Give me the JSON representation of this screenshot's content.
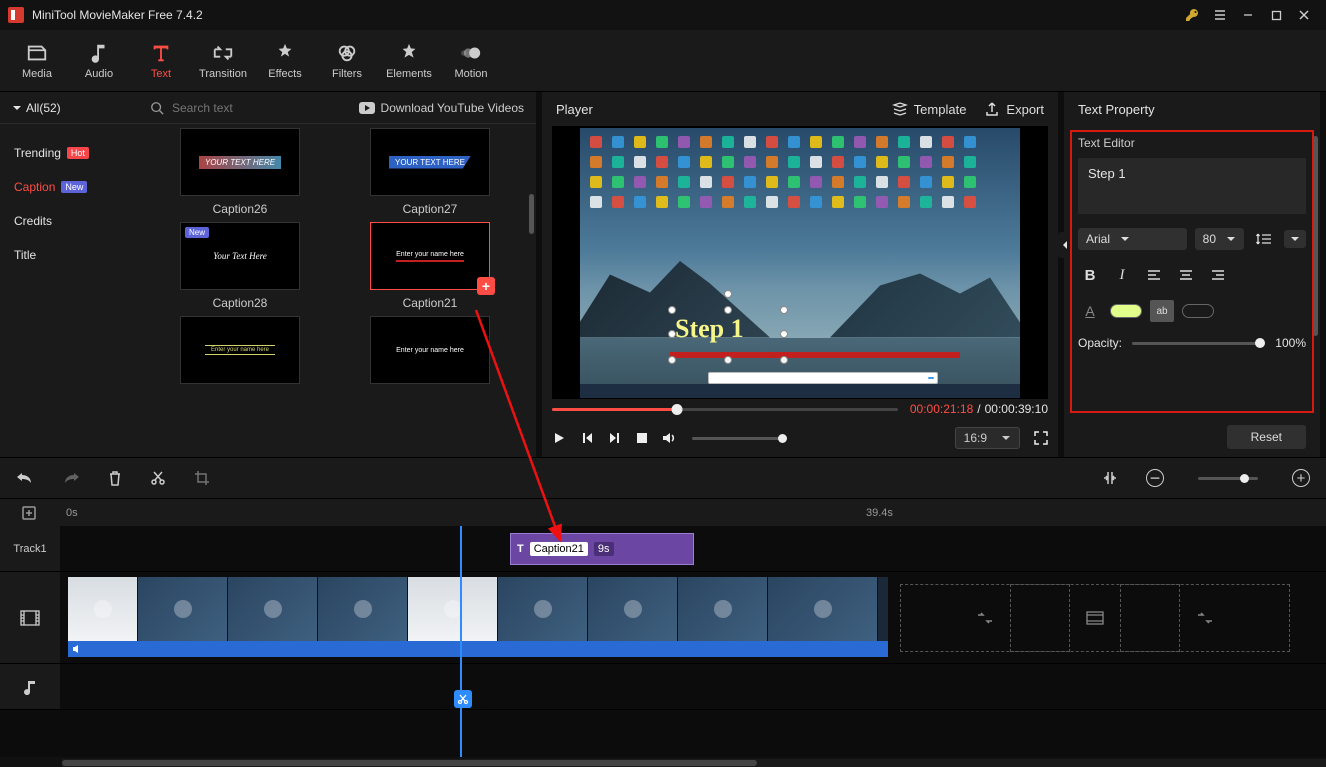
{
  "window": {
    "title": "MiniTool MovieMaker Free 7.4.2"
  },
  "main_tabs": {
    "media": "Media",
    "audio": "Audio",
    "text": "Text",
    "transition": "Transition",
    "effects": "Effects",
    "filters": "Filters",
    "elements": "Elements",
    "motion": "Motion",
    "active": "text"
  },
  "library": {
    "all_count": "All(52)",
    "search_placeholder": "Search text",
    "download_label": "Download YouTube Videos",
    "categories": {
      "trending": "Trending",
      "trending_badge": "Hot",
      "caption": "Caption",
      "caption_badge": "New",
      "credits": "Credits",
      "title": "Title",
      "active": "caption"
    },
    "thumbs": {
      "c26": {
        "label": "Caption26",
        "overlay": "YOUR TEXT HERE"
      },
      "c27": {
        "label": "Caption27",
        "overlay": "YOUR TEXT HERE"
      },
      "c28": {
        "label": "Caption28",
        "overlay": "Your Text Here",
        "badge": "New"
      },
      "c21": {
        "label": "Caption21",
        "overlay": "Enter your name here",
        "selected": true
      },
      "c_next1": {
        "overlay": "Enter your name here"
      },
      "c_next2": {
        "overlay": "Enter your name here"
      }
    }
  },
  "player": {
    "title": "Player",
    "template_btn": "Template",
    "export_btn": "Export",
    "overlay_text": "Step 1",
    "time_current": "00:00:21:18",
    "time_total": "00:00:39:10",
    "aspect_ratio": "16:9",
    "annot_bar_text": "",
    "annot_bar_btn": ""
  },
  "prop_panel": {
    "title": "Text Property",
    "editor_label": "Text Editor",
    "text_value": "Step 1",
    "font_family": "Arial",
    "font_size": "80",
    "opacity_label": "Opacity:",
    "opacity_value": "100%",
    "reset": "Reset",
    "font_color": "#e9ff84",
    "highlight_on": "ab"
  },
  "timeline": {
    "ruler_start": "0s",
    "ruler_mark": "39.4s",
    "track1_label": "Track1",
    "caption_clip": {
      "label": "Caption21",
      "duration": "9s"
    },
    "zoom_icons": {
      "minus": "−",
      "plus": "+"
    }
  }
}
